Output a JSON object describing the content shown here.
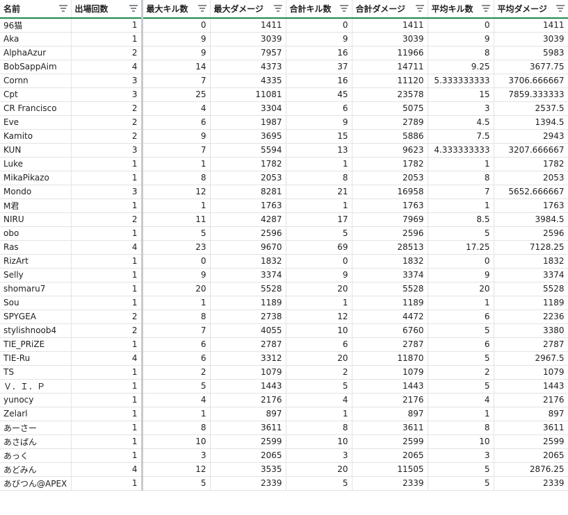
{
  "headers": [
    "名前",
    "出場回数",
    "最大キル数",
    "最大ダメージ",
    "合計キル数",
    "合計ダメージ",
    "平均キル数",
    "平均ダメージ"
  ],
  "rows": [
    [
      "96猫",
      "1",
      "0",
      "1411",
      "0",
      "1411",
      "0",
      "1411"
    ],
    [
      "Aka",
      "1",
      "9",
      "3039",
      "9",
      "3039",
      "9",
      "3039"
    ],
    [
      "AlphaAzur",
      "2",
      "9",
      "7957",
      "16",
      "11966",
      "8",
      "5983"
    ],
    [
      "BobSappAim",
      "4",
      "14",
      "4373",
      "37",
      "14711",
      "9.25",
      "3677.75"
    ],
    [
      "Cornn",
      "3",
      "7",
      "4335",
      "16",
      "11120",
      "5.333333333",
      "3706.666667"
    ],
    [
      "Cpt",
      "3",
      "25",
      "11081",
      "45",
      "23578",
      "15",
      "7859.333333"
    ],
    [
      "CR Francisco",
      "2",
      "4",
      "3304",
      "6",
      "5075",
      "3",
      "2537.5"
    ],
    [
      "Eve",
      "2",
      "6",
      "1987",
      "9",
      "2789",
      "4.5",
      "1394.5"
    ],
    [
      "Kamito",
      "2",
      "9",
      "3695",
      "15",
      "5886",
      "7.5",
      "2943"
    ],
    [
      "KUN",
      "3",
      "7",
      "5594",
      "13",
      "9623",
      "4.333333333",
      "3207.666667"
    ],
    [
      "Luke",
      "1",
      "1",
      "1782",
      "1",
      "1782",
      "1",
      "1782"
    ],
    [
      "MikaPikazo",
      "1",
      "8",
      "2053",
      "8",
      "2053",
      "8",
      "2053"
    ],
    [
      "Mondo",
      "3",
      "12",
      "8281",
      "21",
      "16958",
      "7",
      "5652.666667"
    ],
    [
      "M君",
      "1",
      "1",
      "1763",
      "1",
      "1763",
      "1",
      "1763"
    ],
    [
      "NIRU",
      "2",
      "11",
      "4287",
      "17",
      "7969",
      "8.5",
      "3984.5"
    ],
    [
      "obo",
      "1",
      "5",
      "2596",
      "5",
      "2596",
      "5",
      "2596"
    ],
    [
      "Ras",
      "4",
      "23",
      "9670",
      "69",
      "28513",
      "17.25",
      "7128.25"
    ],
    [
      "RizArt",
      "1",
      "0",
      "1832",
      "0",
      "1832",
      "0",
      "1832"
    ],
    [
      "Selly",
      "1",
      "9",
      "3374",
      "9",
      "3374",
      "9",
      "3374"
    ],
    [
      "shomaru7",
      "1",
      "20",
      "5528",
      "20",
      "5528",
      "20",
      "5528"
    ],
    [
      "Sou",
      "1",
      "1",
      "1189",
      "1",
      "1189",
      "1",
      "1189"
    ],
    [
      "SPYGEA",
      "2",
      "8",
      "2738",
      "12",
      "4472",
      "6",
      "2236"
    ],
    [
      "stylishnoob4",
      "2",
      "7",
      "4055",
      "10",
      "6760",
      "5",
      "3380"
    ],
    [
      "TIE_PRiZE",
      "1",
      "6",
      "2787",
      "6",
      "2787",
      "6",
      "2787"
    ],
    [
      "TIE-Ru",
      "4",
      "6",
      "3312",
      "20",
      "11870",
      "5",
      "2967.5"
    ],
    [
      "TS",
      "1",
      "2",
      "1079",
      "2",
      "1079",
      "2",
      "1079"
    ],
    [
      "Ｖ．Ｉ．Ｐ",
      "1",
      "5",
      "1443",
      "5",
      "1443",
      "5",
      "1443"
    ],
    [
      "yunocy",
      "1",
      "4",
      "2176",
      "4",
      "2176",
      "4",
      "2176"
    ],
    [
      "Zelarl",
      "1",
      "1",
      "897",
      "1",
      "897",
      "1",
      "897"
    ],
    [
      "あーさー",
      "1",
      "8",
      "3611",
      "8",
      "3611",
      "8",
      "3611"
    ],
    [
      "あさぱん",
      "1",
      "10",
      "2599",
      "10",
      "2599",
      "10",
      "2599"
    ],
    [
      "あっく",
      "1",
      "3",
      "2065",
      "3",
      "2065",
      "3",
      "2065"
    ],
    [
      "あどみん",
      "4",
      "12",
      "3535",
      "20",
      "11505",
      "5",
      "2876.25"
    ],
    [
      "あびつん@APEX",
      "1",
      "5",
      "2339",
      "5",
      "2339",
      "5",
      "2339"
    ]
  ],
  "icons": {
    "filter": "filter-icon"
  },
  "colors": {
    "header_underline": "#1a8a4a",
    "gridline": "#e2e3e3",
    "frozen_divider": "#c7cace"
  }
}
